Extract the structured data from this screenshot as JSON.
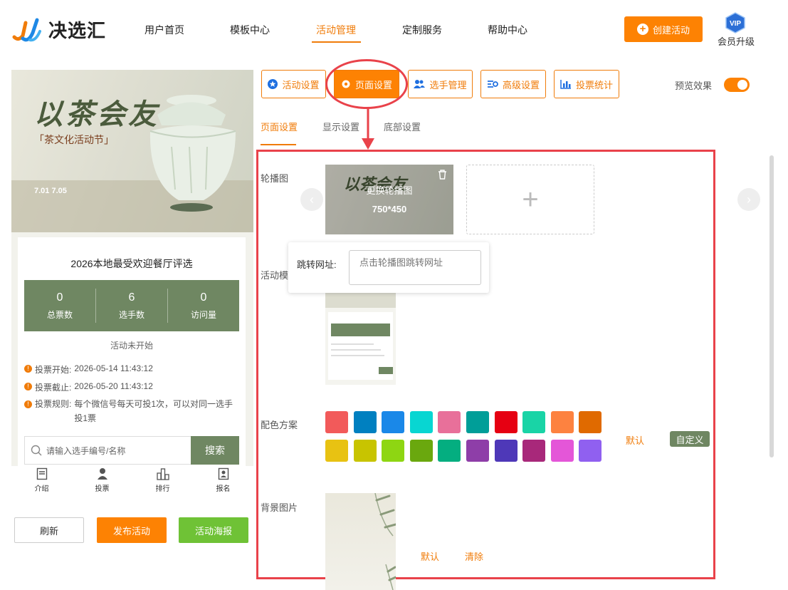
{
  "header": {
    "logo_text": "决选汇",
    "nav": [
      "用户首页",
      "模板中心",
      "活动管理",
      "定制服务",
      "帮助中心"
    ],
    "create_button": "创建活动",
    "vip_badge": "VIP",
    "vip_label": "会员升级"
  },
  "preview": {
    "banner_title": "以茶会友",
    "banner_subtitle": "「茶文化活动节」",
    "banner_date": "7.01 7.05",
    "activity_title": "2026本地最受欢迎餐厅评选",
    "stats": [
      {
        "value": "0",
        "label": "总票数"
      },
      {
        "value": "6",
        "label": "选手数"
      },
      {
        "value": "0",
        "label": "访问量"
      }
    ],
    "status": "活动未开始",
    "info": [
      {
        "label": "投票开始:",
        "value": "2026-05-14 11:43:12"
      },
      {
        "label": "投票截止:",
        "value": "2026-05-20 11:43:12"
      },
      {
        "label": "投票规则:",
        "value": "每个微信号每天可投1次，可以对同一选手投1票"
      }
    ],
    "search_placeholder": "请输入选手编号/名称",
    "search_button": "搜索",
    "tabbar": [
      "介绍",
      "投票",
      "排行",
      "报名"
    ]
  },
  "bottom_buttons": {
    "refresh": "刷新",
    "publish": "发布活动",
    "poster": "活动海报"
  },
  "settings": {
    "top_buttons": [
      "活动设置",
      "页面设置",
      "选手管理",
      "高级设置",
      "投票统计"
    ],
    "preview_label": "预览效果",
    "preview_on": true,
    "sub_tabs": [
      "页面设置",
      "显示设置",
      "底部设置"
    ],
    "carousel_label": "轮播图",
    "carousel_replace": "更换轮播图",
    "carousel_size": "750*450",
    "add_symbol": "+",
    "jump_label": "跳转网址:",
    "jump_placeholder": "点击轮播图跳转网址",
    "template_label": "活动模",
    "color_label": "配色方案",
    "colors": [
      "#f25a5a",
      "#0080c0",
      "#1a88e8",
      "#08d6d2",
      "#e8709a",
      "#009e98",
      "#e60012",
      "#19d4a6",
      "#fd8240",
      "#e06a00",
      "#e8c212",
      "#c8c400",
      "#8ed612",
      "#6aa80e",
      "#04ae80",
      "#8e3ea8",
      "#4e38b8",
      "#a8287a",
      "#e456d8",
      "#9060f0"
    ],
    "color_default": "默认",
    "color_custom": "自定义",
    "bg_label": "背景图片",
    "bg_default": "默认",
    "bg_clear": "清除"
  }
}
